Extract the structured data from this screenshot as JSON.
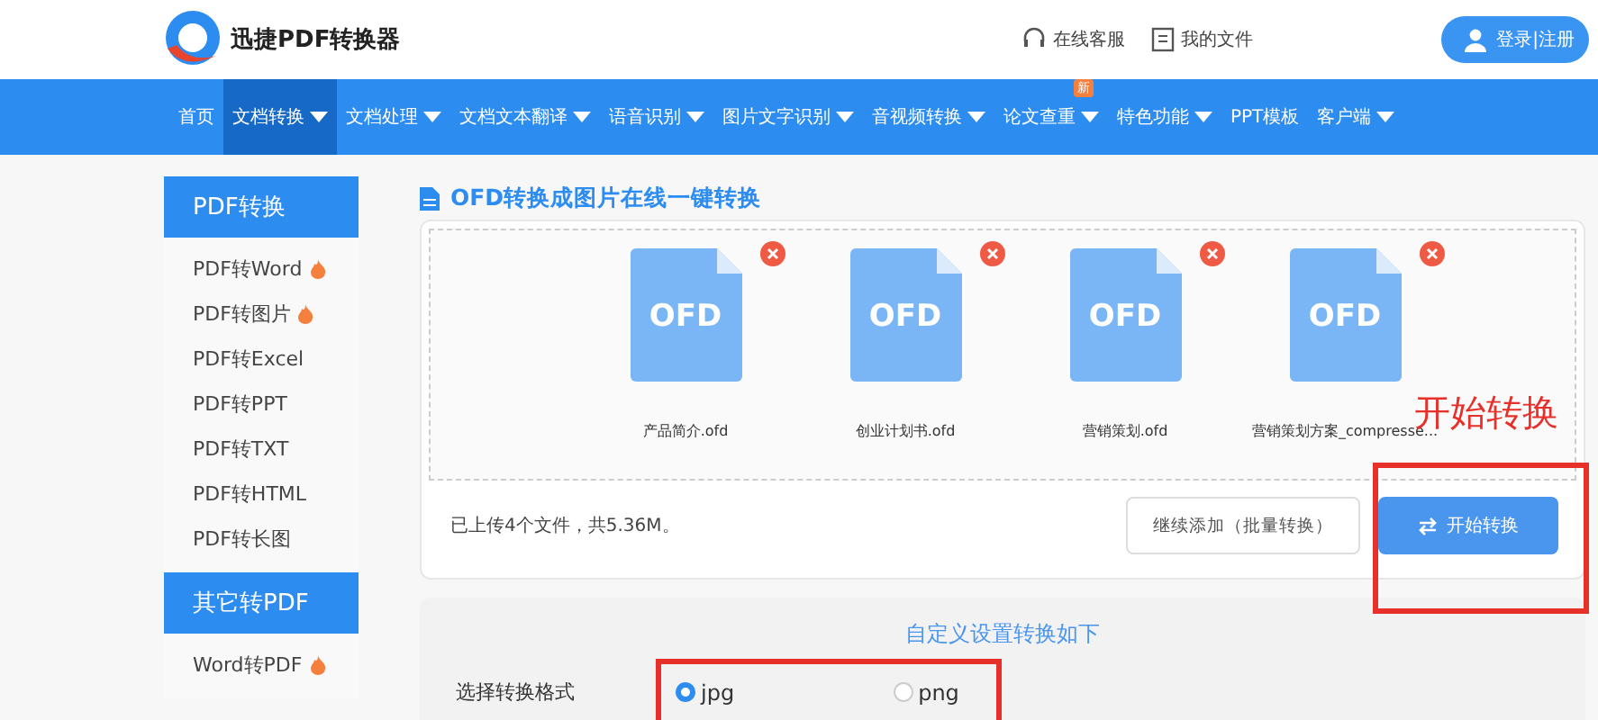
{
  "header": {
    "brand": "迅捷PDF转换器",
    "links": [
      {
        "kind": "support",
        "label": "在线客服"
      },
      {
        "kind": "files",
        "label": "我的文件"
      }
    ],
    "login": "登录|注册"
  },
  "nav": [
    {
      "label": "首页",
      "selected": false,
      "dropdown": false
    },
    {
      "label": "文档转换",
      "selected": true,
      "dropdown": true
    },
    {
      "label": "文档处理",
      "selected": false,
      "dropdown": true
    },
    {
      "label": "文档文本翻译",
      "selected": false,
      "dropdown": true
    },
    {
      "label": "语音识别",
      "selected": false,
      "dropdown": true
    },
    {
      "label": "图片文字识别",
      "selected": false,
      "dropdown": true
    },
    {
      "label": "音视频转换",
      "selected": false,
      "dropdown": true
    },
    {
      "label": "论文查重",
      "selected": false,
      "dropdown": true,
      "badge": "新"
    },
    {
      "label": "特色功能",
      "selected": false,
      "dropdown": true
    },
    {
      "label": "PPT模板",
      "selected": false,
      "dropdown": false
    },
    {
      "label": "客户端",
      "selected": false,
      "dropdown": true
    }
  ],
  "sidebar": [
    {
      "title": "PDF转换",
      "items": [
        {
          "label": "PDF转Word",
          "hot": true
        },
        {
          "label": "PDF转图片",
          "hot": true
        },
        {
          "label": "PDF转Excel",
          "hot": false
        },
        {
          "label": "PDF转PPT",
          "hot": false
        },
        {
          "label": "PDF转TXT",
          "hot": false
        },
        {
          "label": "PDF转HTML",
          "hot": false
        },
        {
          "label": "PDF转长图",
          "hot": false
        }
      ]
    },
    {
      "title": "其它转PDF",
      "items": [
        {
          "label": "Word转PDF",
          "hot": true
        }
      ]
    }
  ],
  "page_title": "OFD转换成图片在线一键转换",
  "files": [
    {
      "type": "OFD",
      "name": "产品简介.ofd"
    },
    {
      "type": "OFD",
      "name": "创业计划书.ofd"
    },
    {
      "type": "OFD",
      "name": "营销策划.ofd"
    },
    {
      "type": "OFD",
      "name": "营销策划方案_compresse..."
    }
  ],
  "upload_status": "已上传4个文件，共5.36M。",
  "add_button": "继续添加（批量转换）",
  "start_button": "开始转换",
  "settings": {
    "title": "自定义设置转换如下",
    "label": "选择转换格式",
    "options": [
      {
        "label": "jpg",
        "selected": true
      },
      {
        "label": "png",
        "selected": false
      }
    ]
  },
  "annotation": "开始转换"
}
